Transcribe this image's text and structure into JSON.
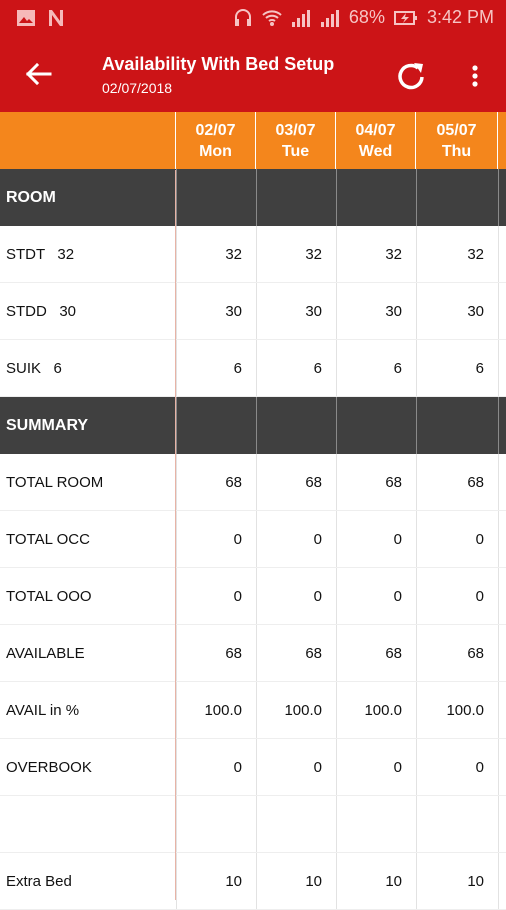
{
  "status_bar": {
    "battery": "68%",
    "time": "3:42 PM"
  },
  "app_bar": {
    "title": "Availability With Bed Setup",
    "date": "02/07/2018"
  },
  "columns": [
    {
      "date": "02/07",
      "day": "Mon"
    },
    {
      "date": "03/07",
      "day": "Tue"
    },
    {
      "date": "04/07",
      "day": "Wed"
    },
    {
      "date": "05/07",
      "day": "Thu"
    }
  ],
  "sections": {
    "room": "ROOM",
    "summary": "SUMMARY"
  },
  "room_rows": [
    {
      "label": "STDT   32",
      "values": [
        "32",
        "32",
        "32",
        "32"
      ]
    },
    {
      "label": "STDD   30",
      "values": [
        "30",
        "30",
        "30",
        "30"
      ]
    },
    {
      "label": "SUIK   6",
      "values": [
        "6",
        "6",
        "6",
        "6"
      ]
    }
  ],
  "summary_rows": [
    {
      "label": "TOTAL ROOM",
      "values": [
        "68",
        "68",
        "68",
        "68"
      ]
    },
    {
      "label": "TOTAL OCC",
      "values": [
        "0",
        "0",
        "0",
        "0"
      ]
    },
    {
      "label": "TOTAL OOO",
      "values": [
        "0",
        "0",
        "0",
        "0"
      ]
    },
    {
      "label": "AVAILABLE",
      "values": [
        "68",
        "68",
        "68",
        "68"
      ]
    },
    {
      "label": "AVAIL in %",
      "values": [
        "100.0",
        "100.0",
        "100.0",
        "100.0"
      ]
    },
    {
      "label": "OVERBOOK",
      "values": [
        "0",
        "0",
        "0",
        "0"
      ]
    }
  ],
  "extra_rows": [
    {
      "label": "Extra Bed",
      "values": [
        "10",
        "10",
        "10",
        "10"
      ]
    }
  ]
}
